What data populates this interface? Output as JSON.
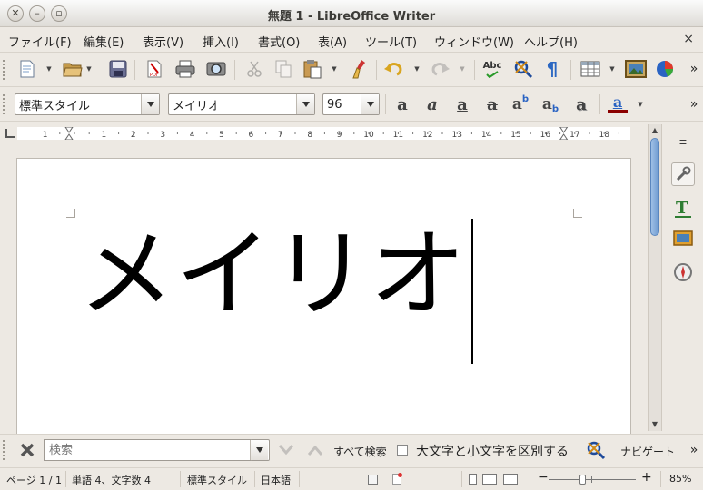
{
  "window": {
    "title": "無題 1 - LibreOffice Writer"
  },
  "menu": {
    "items": [
      "ファイル(F)",
      "編集(E)",
      "表示(V)",
      "挿入(I)",
      "書式(O)",
      "表(A)",
      "ツール(T)",
      "ウィンドウ(W)",
      "ヘルプ(H)"
    ],
    "close_glyph": "×"
  },
  "standard_toolbar": {
    "icons": [
      "new-document-icon",
      "open-folder-icon",
      "save-icon",
      "export-pdf-icon",
      "print-icon",
      "print-preview-icon",
      "cut-icon",
      "copy-icon",
      "paste-icon",
      "clone-formatting-icon",
      "undo-icon",
      "redo-icon",
      "spellcheck-icon",
      "autocheck-icon",
      "formatting-marks-icon",
      "table-icon",
      "image-icon",
      "chart-icon"
    ],
    "spellcheck_label": "Abc",
    "pilcrow": "¶"
  },
  "formatting_toolbar": {
    "paragraph_style": "標準スタイル",
    "font_name": "メイリオ",
    "font_size": "96",
    "font_color": "#8b0000"
  },
  "ruler": {
    "labels": [
      "1",
      "1",
      "2",
      "3",
      "4",
      "5",
      "6",
      "7",
      "8",
      "9",
      "10",
      "11",
      "12",
      "13",
      "14",
      "15",
      "16",
      "17",
      "18"
    ]
  },
  "document": {
    "text": "メイリオ"
  },
  "findbar": {
    "placeholder": "検索",
    "find_all_label": "すべて検索",
    "match_case_label": "大文字と小文字を区別する",
    "match_case_checked": false,
    "navigator_label": "ナビゲート"
  },
  "status": {
    "page": "ページ 1 / 1",
    "words": "単語 4、文字数 4",
    "style": "標準スタイル",
    "language": "日本語",
    "zoom": "85%",
    "zoom_level": 85
  }
}
